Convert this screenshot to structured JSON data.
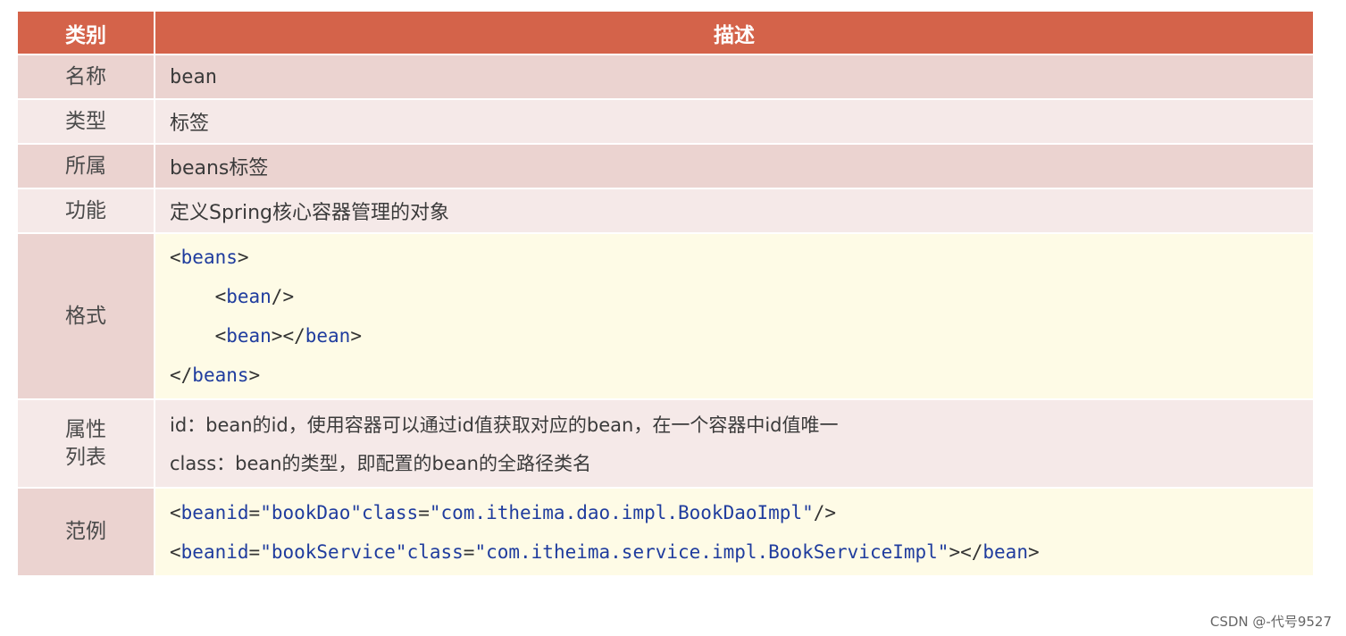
{
  "header": {
    "col_category": "类别",
    "col_description": "描述"
  },
  "rows": {
    "name": {
      "label": "名称",
      "value": "bean"
    },
    "type": {
      "label": "类型",
      "value": "标签"
    },
    "parent": {
      "label": "所属",
      "value": "beans标签"
    },
    "function": {
      "label": "功能",
      "value": "定义Spring核心容器管理的对象"
    },
    "format": {
      "label": "格式",
      "lines": [
        "<beans>",
        "    <bean/>",
        "    <bean></bean>",
        "</beans>"
      ]
    },
    "attributes": {
      "label_line1": "属性",
      "label_line2": "列表",
      "lines": [
        "id：bean的id，使用容器可以通过id值获取对应的bean，在一个容器中id值唯一",
        "class：bean的类型，即配置的bean的全路径类名"
      ]
    },
    "example": {
      "label": "范例",
      "lines": [
        "<bean id=\"bookDao\" class=\"com.itheima.dao.impl.BookDaoImpl\"/>",
        "<bean id=\"bookService\" class=\"com.itheima.service.impl.BookServiceImpl\"></bean>"
      ]
    }
  },
  "watermark": "CSDN @-代号9527",
  "colors": {
    "header_bg": "#d4634a",
    "row_dark": "#ebd3d0",
    "row_light": "#f5e9e8",
    "code_bg": "#fefbe6",
    "code_keyword": "#1f3c9e"
  }
}
